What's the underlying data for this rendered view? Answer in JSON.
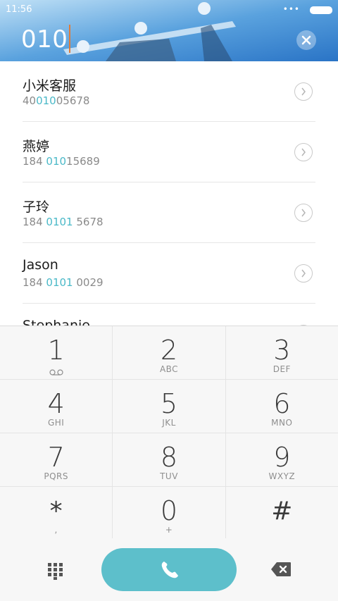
{
  "status": {
    "time": "11:56",
    "dots": "•••"
  },
  "dial": {
    "number": "010"
  },
  "contacts": [
    {
      "name": "小米客服",
      "pre": "40",
      "match": "010",
      "post": "05678"
    },
    {
      "name": "燕婷",
      "pre": "184 ",
      "match": "010",
      "post": "15689"
    },
    {
      "name": "子玲",
      "pre": "184 ",
      "match": "0101",
      "post": " 5678"
    },
    {
      "name": "Jason",
      "pre": "184 ",
      "match": "0101",
      "post": " 0029"
    },
    {
      "name": "Stephanie",
      "pre": "",
      "match": "",
      "post": ""
    }
  ],
  "keys": {
    "k1": {
      "digit": "1"
    },
    "k2": {
      "digit": "2",
      "letters": "ABC"
    },
    "k3": {
      "digit": "3",
      "letters": "DEF"
    },
    "k4": {
      "digit": "4",
      "letters": "GHI"
    },
    "k5": {
      "digit": "5",
      "letters": "JKL"
    },
    "k6": {
      "digit": "6",
      "letters": "MNO"
    },
    "k7": {
      "digit": "7",
      "letters": "PQRS"
    },
    "k8": {
      "digit": "8",
      "letters": "TUV"
    },
    "k9": {
      "digit": "9",
      "letters": "WXYZ"
    },
    "kstar": {
      "symbol": "*",
      "sub": ","
    },
    "k0": {
      "digit": "0",
      "sub": "+"
    },
    "khash": {
      "symbol": "#"
    }
  },
  "colors": {
    "accent": "#5dbfcb",
    "highlight": "#4bb9c8"
  }
}
